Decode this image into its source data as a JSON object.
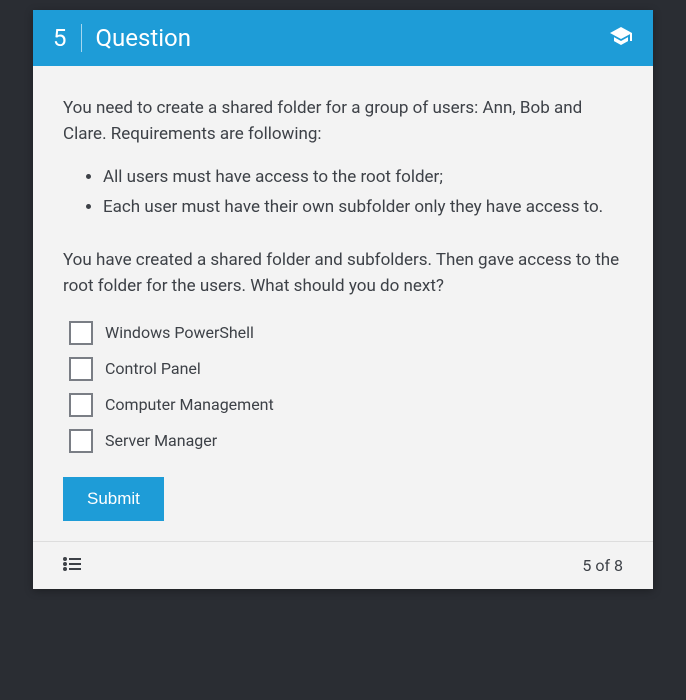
{
  "header": {
    "number": "5",
    "title": "Question"
  },
  "question": {
    "intro": "You need to create a shared folder for a group of users: Ann, Bob and Clare. Requirements are following:",
    "requirements": [
      "All users must have access to the root folder;",
      "Each user must have their own subfolder only they have access to."
    ],
    "followup": "You have created a shared folder and subfolders. Then gave access to the root folder for the users. What should you do next?"
  },
  "options": [
    {
      "label": "Windows PowerShell"
    },
    {
      "label": "Control Panel"
    },
    {
      "label": "Computer Management"
    },
    {
      "label": "Server Manager"
    }
  ],
  "submit_label": "Submit",
  "footer": {
    "progress": "5 of 8"
  }
}
